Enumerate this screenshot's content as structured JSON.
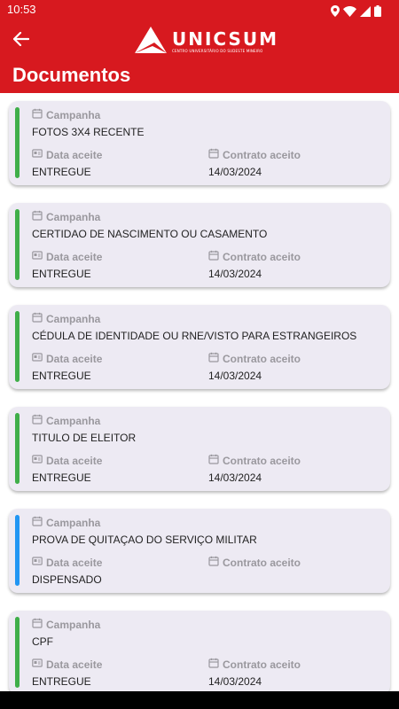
{
  "status_bar": {
    "time": "10:53"
  },
  "app_bar": {
    "logo_text": "UNICSUM",
    "logo_subtitle": "CENTRO UNIVERSITÁRIO DO SUDESTE MINEIRO"
  },
  "page": {
    "title": "Documentos"
  },
  "labels": {
    "campanha": "Campanha",
    "data_aceite": "Data aceite",
    "contrato_aceito": "Contrato aceito"
  },
  "documents": [
    {
      "name": "FOTOS 3X4 RECENTE",
      "status": "ENTREGUE",
      "contract_date": "14/03/2024",
      "accent": "#3fae49"
    },
    {
      "name": "CERTIDAO DE NASCIMENTO OU CASAMENTO",
      "status": "ENTREGUE",
      "contract_date": "14/03/2024",
      "accent": "#3fae49"
    },
    {
      "name": "CÉDULA DE IDENTIDADE OU RNE/VISTO PARA ESTRANGEIROS",
      "status": "ENTREGUE",
      "contract_date": "14/03/2024",
      "accent": "#3fae49"
    },
    {
      "name": "TITULO DE ELEITOR",
      "status": "ENTREGUE",
      "contract_date": "14/03/2024",
      "accent": "#3fae49"
    },
    {
      "name": "PROVA DE QUITAÇAO DO SERVIÇO MILITAR",
      "status": "DISPENSADO",
      "contract_date": "",
      "accent": "#2196f3"
    },
    {
      "name": "CPF",
      "status": "ENTREGUE",
      "contract_date": "14/03/2024",
      "accent": "#3fae49"
    }
  ]
}
